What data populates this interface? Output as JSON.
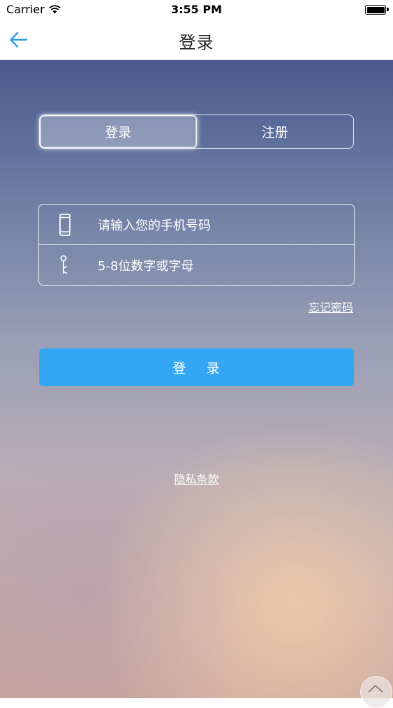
{
  "status_bar": {
    "carrier": "Carrier",
    "time": "3:55 PM",
    "wifi_icon": "wifi-icon",
    "battery_icon": "battery-icon"
  },
  "nav": {
    "title": "登录",
    "back_icon": "back-arrow-icon"
  },
  "segment": {
    "login": "登录",
    "register": "注册",
    "selected": "login"
  },
  "form": {
    "phone_placeholder": "请输入您的手机号码",
    "phone_value": "",
    "phone_icon": "phone-icon",
    "password_placeholder": "5-8位数字或字母",
    "password_value": "",
    "password_icon": "key-icon"
  },
  "forgot_password": "忘记密码",
  "login_button": "登    录",
  "privacy_link": "隐私条款",
  "scroll_top_icon": "chevron-up-icon",
  "colors": {
    "accent": "#33a7f4",
    "nav_back": "#2b9ee6"
  }
}
